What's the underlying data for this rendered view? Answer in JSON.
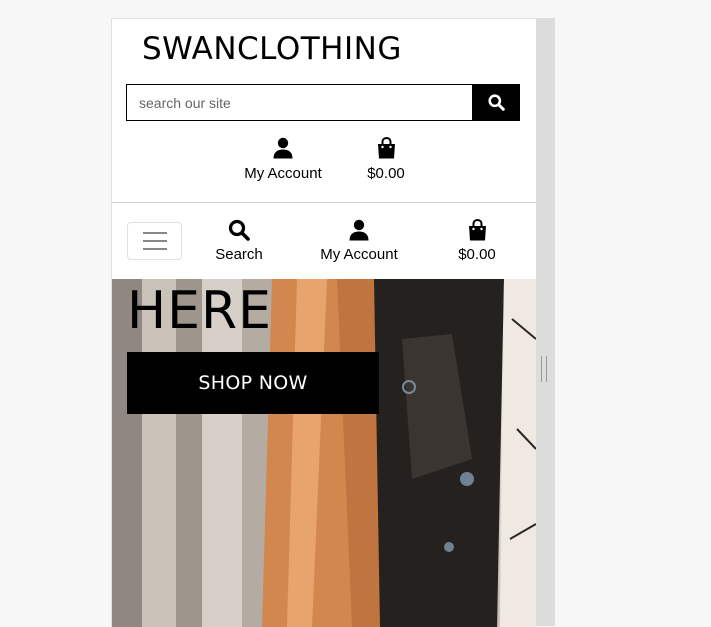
{
  "header": {
    "brand": "SWANCLOTHING"
  },
  "search": {
    "placeholder": "search our site",
    "button_icon": "search-icon"
  },
  "top_links": {
    "account_label": "My Account",
    "account_icon": "user-icon",
    "bag_total": "$0.00",
    "bag_icon": "shopping-bag-icon"
  },
  "mobile_nav": {
    "menu_icon": "hamburger-icon",
    "search_label": "Search",
    "account_label": "My Account",
    "bag_total": "$0.00"
  },
  "hero": {
    "heading": "HERE",
    "cta_label": "SHOP NOW"
  },
  "colors": {
    "primary": "#000000",
    "background": "#ffffff"
  }
}
